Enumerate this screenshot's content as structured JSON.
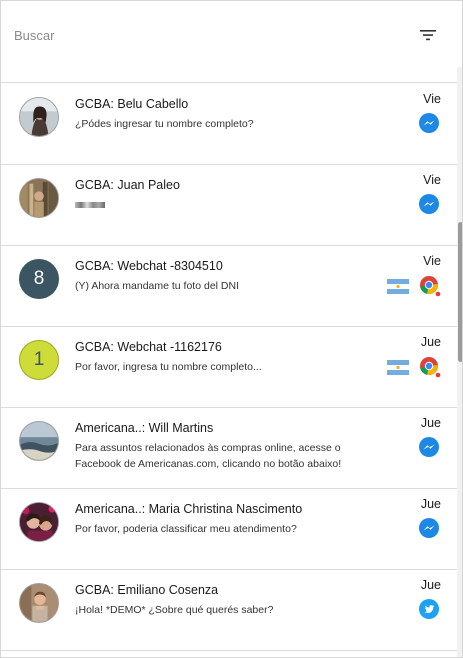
{
  "search": {
    "placeholder": "Buscar",
    "value": ""
  },
  "filter_icon": "filter-list-icon",
  "conversations": [
    {
      "title": "GCBA: Belu Cabello",
      "preview": "¿Pódes ingresar tu nombre completo?",
      "time": "Vie",
      "channel": "messenger",
      "avatar": "photo"
    },
    {
      "title": "GCBA: Juan Paleo",
      "preview": "",
      "time": "Vie",
      "channel": "messenger",
      "avatar": "photo"
    },
    {
      "title": "GCBA: Webchat -8304510",
      "preview": "(Y) Ahora mandame tu foto del DNI",
      "time": "Vie",
      "channel": "webchat",
      "avatar_letter": "8",
      "avatar_color": "#3b5563",
      "flag": "argentina-flag-icon"
    },
    {
      "title": "GCBA: Webchat -1162176",
      "preview": "Por favor, ingresa tu nombre completo...",
      "time": "Jue",
      "channel": "webchat",
      "avatar_letter": "1",
      "avatar_color": "#cddc39",
      "flag": "argentina-flag-icon"
    },
    {
      "title": "Americana..: Will Martins",
      "preview": "Para assuntos relacionados às compras online, acesse o Facebook de Americanas.com, clicando no botão abaixo!",
      "time": "Jue",
      "channel": "messenger",
      "avatar": "photo"
    },
    {
      "title": "Americana..: Maria Christina Nascimento",
      "preview": "Por favor, poderia classificar meu atendimento?",
      "time": "Jue",
      "channel": "messenger",
      "avatar": "photo"
    },
    {
      "title": "GCBA: Emiliano Cosenza",
      "preview": "¡Hola! *DEMO* ¿Sobre qué querés saber?",
      "time": "Jue",
      "channel": "twitter",
      "avatar": "photo"
    }
  ],
  "colors": {
    "messenger": "#1e88e5",
    "twitter": "#1da1f2",
    "unread_dot": "#e53935",
    "divider": "#dcdcdc"
  }
}
